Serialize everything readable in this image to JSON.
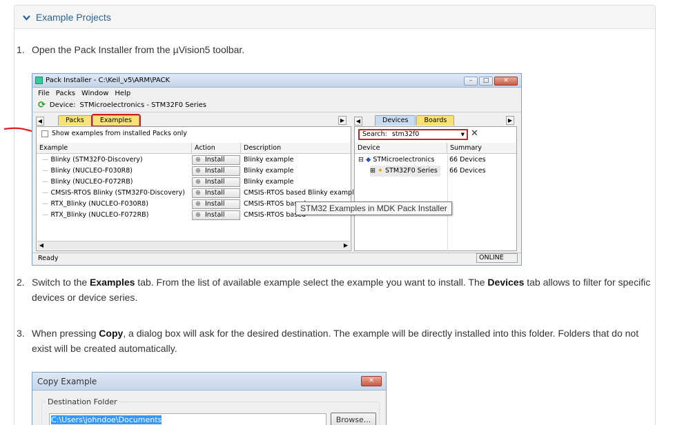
{
  "panel": {
    "title": "Example Projects"
  },
  "steps": [
    {
      "num": "1.",
      "text": "Open the Pack Installer from the µVision5 toolbar."
    },
    {
      "num": "2.",
      "pre": "Switch to the ",
      "b1": "Examples",
      "mid": " tab. From the list of available example select the example you want to install. The ",
      "b2": "Devices",
      "post": " tab allows to filter for specific devices or device series."
    },
    {
      "num": "3.",
      "pre": "When pressing ",
      "b1": "Copy",
      "post": ", a dialog box will ask for the desired destination. The example will be directly installed into this folder. Folders that do not exist will be created automatically."
    }
  ],
  "installer": {
    "title": "Pack Installer - C:\\Keil_v5\\ARM\\PACK",
    "menu": [
      "File",
      "Packs",
      "Window",
      "Help"
    ],
    "device_label": "Device:",
    "device_value": "STMicroelectronics - STM32F0 Series",
    "left_tabs": [
      "Packs",
      "Examples"
    ],
    "right_tabs": [
      "Devices",
      "Boards"
    ],
    "checkbox_label": "Show examples from installed Packs only",
    "columns": [
      "Example",
      "Action",
      "Description"
    ],
    "rows": [
      {
        "example": "Blinky (STM32F0-Discovery)",
        "action": "Install",
        "desc": "Blinky example"
      },
      {
        "example": "Blinky (NUCLEO-F030R8)",
        "action": "Install",
        "desc": "Blinky example"
      },
      {
        "example": "Blinky (NUCLEO-F072RB)",
        "action": "Install",
        "desc": "Blinky example"
      },
      {
        "example": "CMSIS-RTOS Blinky (STM32F0-Discovery)",
        "action": "Install",
        "desc": "CMSIS-RTOS based Blinky example"
      },
      {
        "example": "RTX_Blinky (NUCLEO-F030R8)",
        "action": "Install",
        "desc": "CMSIS-RTOS based"
      },
      {
        "example": "RTX_Blinky (NUCLEO-F072RB)",
        "action": "Install",
        "desc": "CMSIS-RTOS based"
      }
    ],
    "search_label": "Search:",
    "search_value": "stm32f0",
    "right_columns": [
      "Device",
      "Summary"
    ],
    "tree": [
      {
        "name": "STMicroelectronics",
        "summary": "66 Devices"
      },
      {
        "name": "STM32F0 Series",
        "summary": "66 Devices"
      }
    ],
    "status_left": "Ready",
    "status_right": "ONLINE",
    "tooltip": "STM32 Examples in MDK Pack Installer"
  },
  "dialog": {
    "title": "Copy Example",
    "group_label": "Destination Folder",
    "path": "C:\\Users\\johndoe\\Documents",
    "browse": "Browse..."
  }
}
